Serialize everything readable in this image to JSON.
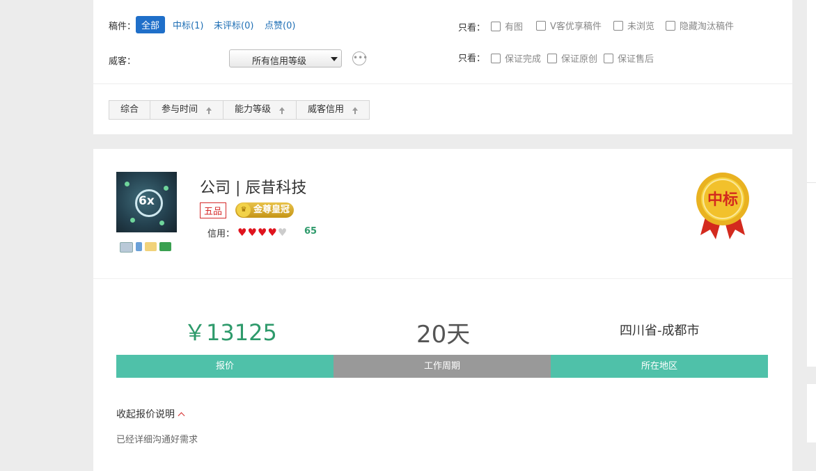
{
  "filter": {
    "drafts_label": "稿件：",
    "tabs": [
      {
        "label": "全部",
        "active": true
      },
      {
        "label": "中标(1)",
        "active": false
      },
      {
        "label": "未评标(0)",
        "active": false
      },
      {
        "label": "点赞(0)",
        "active": false
      }
    ],
    "only_label_1": "只看：",
    "only_options_1": [
      "有图",
      "V客优享稿件",
      "未浏览",
      "隐藏淘汰稿件"
    ],
    "weike_label": "威客：",
    "credit_select_value": "所有信用等级",
    "more_icon": "•••",
    "only_label_2": "只看：",
    "only_options_2": [
      "保证完成",
      "保证原创",
      "保证售后"
    ]
  },
  "sort": {
    "items": [
      "综合",
      "参与时间",
      "能力等级",
      "威客信用"
    ]
  },
  "bid": {
    "avatar_logo": "6x",
    "company_name": "公司 | 辰昔科技",
    "rank_badge": "五品",
    "crown_badge": "金尊皇冠",
    "crown_icon": "♛",
    "credit_label": "信用：",
    "hearts_filled": "♥♥♥♥",
    "hearts_empty": "♥",
    "credit_score": "65",
    "medal_text": "中标",
    "price": "￥13125",
    "period": "20天",
    "region": "四川省-成都市",
    "bar_price": "报价",
    "bar_period": "工作周期",
    "bar_region": "所在地区",
    "collapse_label": "收起报价说明",
    "remark": "已经详细沟通好需求"
  },
  "colors": {
    "accent_blue": "#1f6fc9",
    "green": "#2e9a6b",
    "teal_bar": "#4fc1a9",
    "grey_bar": "#999999",
    "red": "#d52a2a"
  }
}
